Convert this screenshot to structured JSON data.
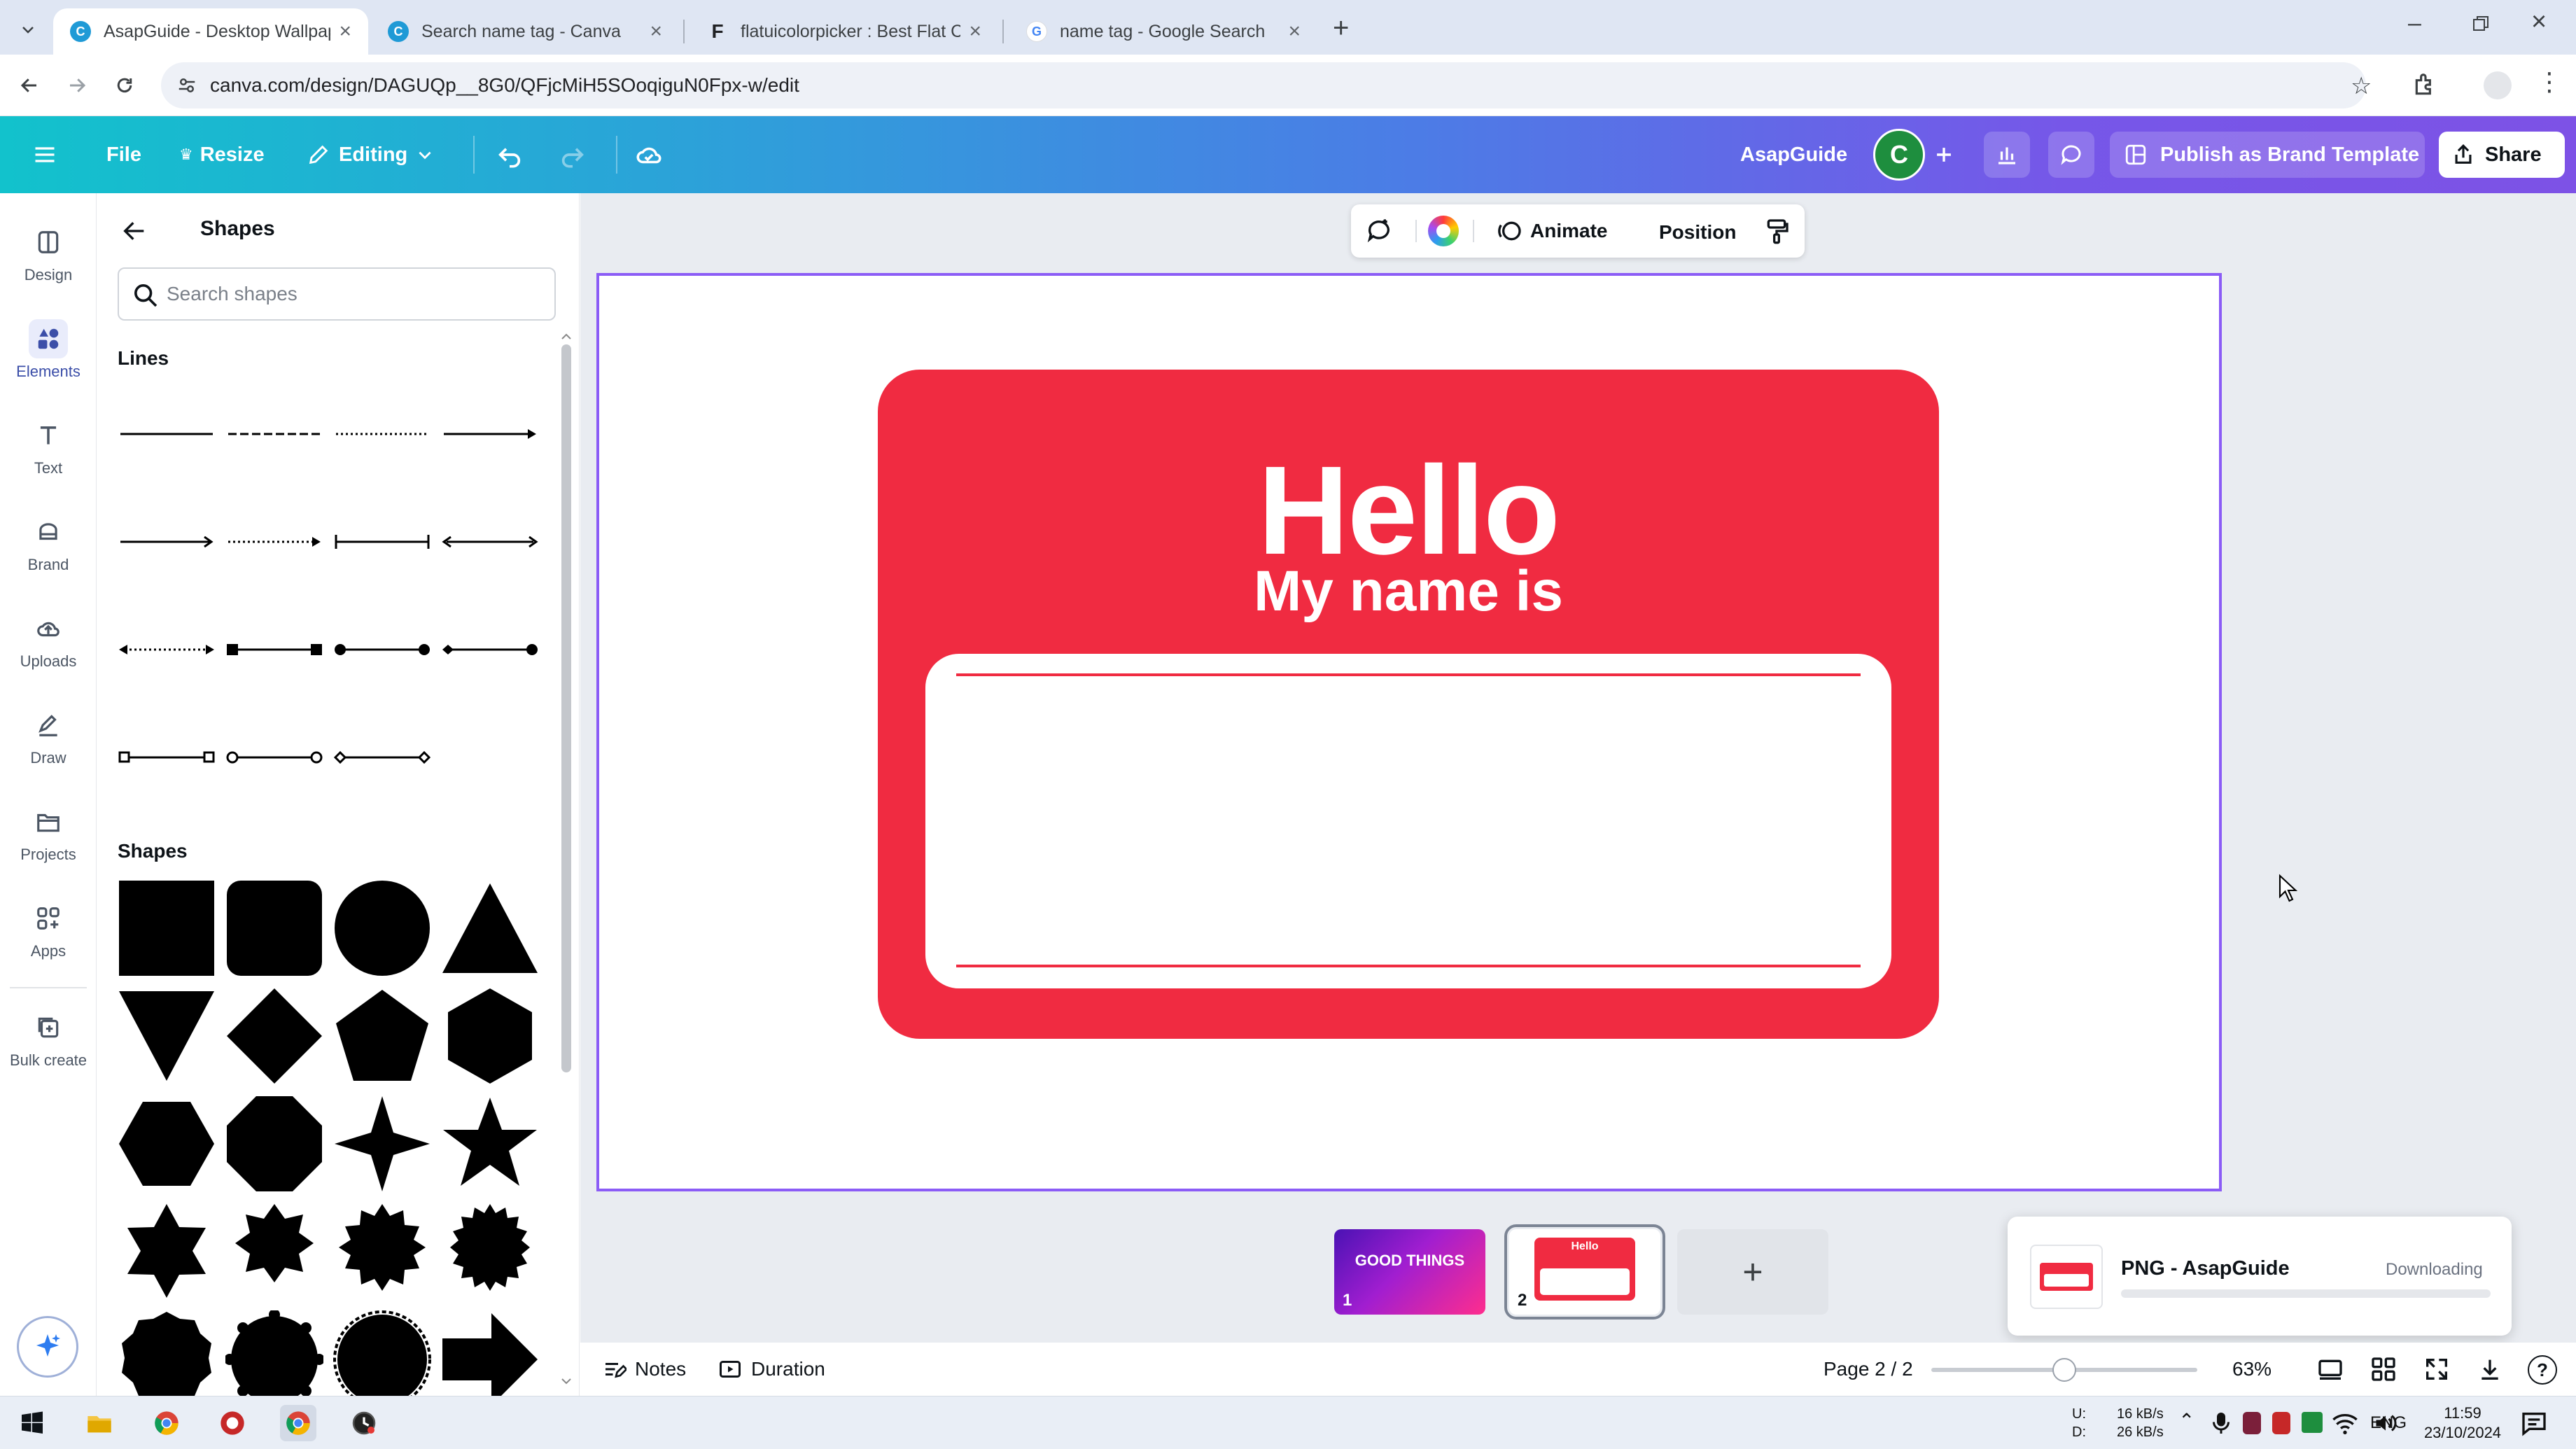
{
  "browser": {
    "tabs": [
      {
        "title": "AsapGuide - Desktop Wallpape",
        "favicon": "canva-favicon",
        "active": true
      },
      {
        "title": "Search name tag - Canva",
        "favicon": "canva-favicon",
        "active": false
      },
      {
        "title": "flatuicolorpicker : Best Flat Colo",
        "favicon": "f-favicon",
        "active": false
      },
      {
        "title": "name tag - Google Search",
        "favicon": "google-favicon",
        "active": false
      }
    ],
    "url": "canva.com/design/DAGUQp__8G0/QFjcMiH5SOoqiguN0Fpx-w/edit"
  },
  "header": {
    "file_label": "File",
    "resize_label": "Resize",
    "editing_label": "Editing",
    "team_name": "AsapGuide",
    "avatar_letter": "C",
    "publish_label": "Publish as Brand Template",
    "share_label": "Share"
  },
  "rail": {
    "items": [
      {
        "label": "Design",
        "icon": "design-icon"
      },
      {
        "label": "Elements",
        "icon": "elements-icon"
      },
      {
        "label": "Text",
        "icon": "text-icon"
      },
      {
        "label": "Brand",
        "icon": "brand-icon"
      },
      {
        "label": "Uploads",
        "icon": "uploads-icon"
      },
      {
        "label": "Draw",
        "icon": "draw-icon"
      },
      {
        "label": "Projects",
        "icon": "projects-icon"
      },
      {
        "label": "Apps",
        "icon": "apps-icon"
      },
      {
        "label": "Bulk create",
        "icon": "bulk-create-icon"
      }
    ],
    "active": "Elements"
  },
  "panel": {
    "title": "Shapes",
    "search_placeholder": "Search shapes",
    "lines_title": "Lines",
    "shapes_title": "Shapes"
  },
  "toolbar": {
    "animate_label": "Animate",
    "position_label": "Position"
  },
  "design": {
    "hello": "Hello",
    "my_name_is": "My name is",
    "tag_color": "#f02b41"
  },
  "pages": {
    "thumb1_text": "GOOD THINGS",
    "thumb1_number": "1",
    "thumb2_text": "Hello",
    "thumb2_number": "2"
  },
  "download": {
    "title": "PNG - AsapGuide",
    "status": "Downloading"
  },
  "bottom": {
    "notes_label": "Notes",
    "duration_label": "Duration",
    "page_indicator": "Page 2 / 2",
    "zoom": "63%",
    "zoom_fraction": 0.5
  },
  "taskbar": {
    "net_up": "16 kB/s",
    "net_down": "26 kB/s",
    "net_up_label": "U:",
    "net_down_label": "D:",
    "lang": "ENG",
    "time": "11:59",
    "date": "23/10/2024"
  }
}
